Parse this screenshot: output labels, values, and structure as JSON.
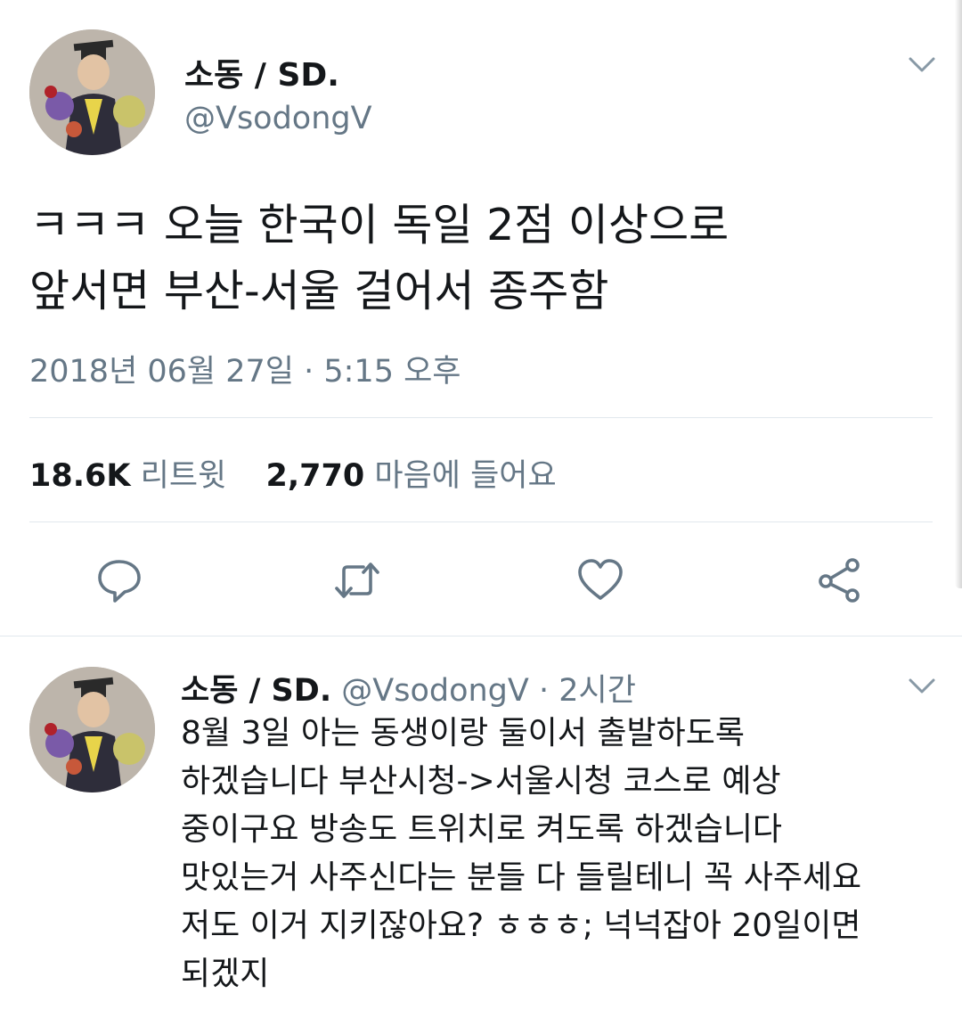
{
  "tweet": {
    "display_name": "소동 / SD.",
    "handle": "@VsodongV",
    "text_lines": [
      "ㅋㅋㅋ 오늘 한국이 독일 2점 이상으로",
      "앞서면 부산-서울 걸어서 종주함"
    ],
    "timestamp": "2018년 06월 27일 · 5:15 오후",
    "stats": {
      "retweets_count": "18.6K",
      "retweets_label": "리트윗",
      "likes_count": "2,770",
      "likes_label": "마음에 들어요"
    },
    "actions": [
      "reply-icon",
      "retweet-icon",
      "like-icon",
      "share-icon"
    ]
  },
  "reply": {
    "display_name": "소동 / SD.",
    "handle": "@VsodongV",
    "time": "· 2시간",
    "text_lines": [
      "8월 3일 아는 동생이랑 둘이서 출발하도록",
      "하겠습니다 부산시청->서울시청 코스로 예상",
      "중이구요 방송도 트위치로 켜도록 하겠습니다",
      "맛있는거 사주신다는 분들 다 들릴테니 꼭 사주세요",
      "저도 이거 지키잖아요? ㅎㅎㅎ; 넉넉잡아 20일이면",
      "되겠지"
    ]
  },
  "colors": {
    "text": "#14171a",
    "secondary": "#657786",
    "divider": "#e1e8ed"
  }
}
